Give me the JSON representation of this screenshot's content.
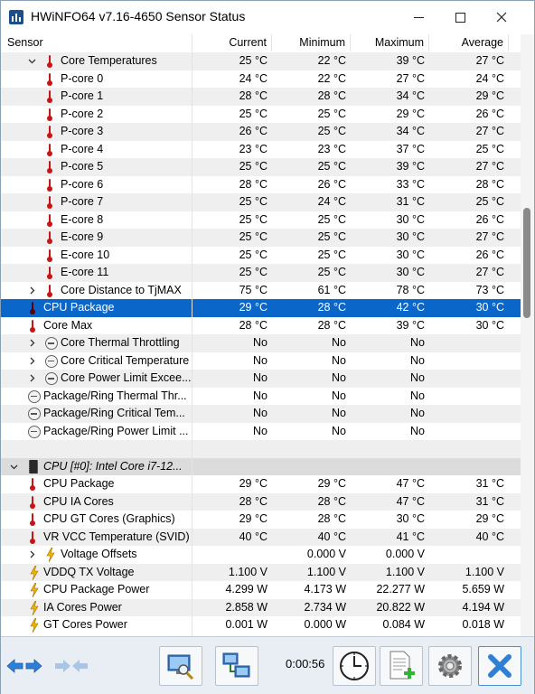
{
  "window": {
    "title": "HWiNFO64 v7.16-4650 Sensor Status"
  },
  "columns": {
    "sensor": "Sensor",
    "current": "Current",
    "minimum": "Minimum",
    "maximum": "Maximum",
    "average": "Average"
  },
  "rows": [
    {
      "label": "Core Temperatures",
      "cur": "25 °C",
      "min": "22 °C",
      "max": "39 °C",
      "avg": "27 °C"
    },
    {
      "label": "P-core 0",
      "cur": "24 °C",
      "min": "22 °C",
      "max": "27 °C",
      "avg": "24 °C"
    },
    {
      "label": "P-core 1",
      "cur": "28 °C",
      "min": "28 °C",
      "max": "34 °C",
      "avg": "29 °C"
    },
    {
      "label": "P-core 2",
      "cur": "25 °C",
      "min": "25 °C",
      "max": "29 °C",
      "avg": "26 °C"
    },
    {
      "label": "P-core 3",
      "cur": "26 °C",
      "min": "25 °C",
      "max": "34 °C",
      "avg": "27 °C"
    },
    {
      "label": "P-core 4",
      "cur": "23 °C",
      "min": "23 °C",
      "max": "37 °C",
      "avg": "25 °C"
    },
    {
      "label": "P-core 5",
      "cur": "25 °C",
      "min": "25 °C",
      "max": "39 °C",
      "avg": "27 °C"
    },
    {
      "label": "P-core 6",
      "cur": "28 °C",
      "min": "26 °C",
      "max": "33 °C",
      "avg": "28 °C"
    },
    {
      "label": "P-core 7",
      "cur": "25 °C",
      "min": "24 °C",
      "max": "31 °C",
      "avg": "25 °C"
    },
    {
      "label": "E-core 8",
      "cur": "25 °C",
      "min": "25 °C",
      "max": "30 °C",
      "avg": "26 °C"
    },
    {
      "label": "E-core 9",
      "cur": "25 °C",
      "min": "25 °C",
      "max": "30 °C",
      "avg": "27 °C"
    },
    {
      "label": "E-core 10",
      "cur": "25 °C",
      "min": "25 °C",
      "max": "30 °C",
      "avg": "26 °C"
    },
    {
      "label": "E-core 11",
      "cur": "25 °C",
      "min": "25 °C",
      "max": "30 °C",
      "avg": "27 °C"
    },
    {
      "label": "Core Distance to TjMAX",
      "cur": "75 °C",
      "min": "61 °C",
      "max": "78 °C",
      "avg": "73 °C"
    },
    {
      "label": "CPU Package",
      "cur": "29 °C",
      "min": "28 °C",
      "max": "42 °C",
      "avg": "30 °C"
    },
    {
      "label": "Core Max",
      "cur": "28 °C",
      "min": "28 °C",
      "max": "39 °C",
      "avg": "30 °C"
    },
    {
      "label": "Core Thermal Throttling",
      "cur": "No",
      "min": "No",
      "max": "No",
      "avg": ""
    },
    {
      "label": "Core Critical Temperature",
      "cur": "No",
      "min": "No",
      "max": "No",
      "avg": ""
    },
    {
      "label": "Core Power Limit Excee...",
      "cur": "No",
      "min": "No",
      "max": "No",
      "avg": ""
    },
    {
      "label": "Package/Ring Thermal Thr...",
      "cur": "No",
      "min": "No",
      "max": "No",
      "avg": ""
    },
    {
      "label": "Package/Ring Critical Tem...",
      "cur": "No",
      "min": "No",
      "max": "No",
      "avg": ""
    },
    {
      "label": "Package/Ring Power Limit ...",
      "cur": "No",
      "min": "No",
      "max": "No",
      "avg": ""
    },
    {
      "label": "",
      "cur": "",
      "min": "",
      "max": "",
      "avg": ""
    },
    {
      "label": "CPU [#0]: Intel Core i7-12...",
      "cur": "",
      "min": "",
      "max": "",
      "avg": ""
    },
    {
      "label": "CPU Package",
      "cur": "29 °C",
      "min": "29 °C",
      "max": "47 °C",
      "avg": "31 °C"
    },
    {
      "label": "CPU IA Cores",
      "cur": "28 °C",
      "min": "28 °C",
      "max": "47 °C",
      "avg": "31 °C"
    },
    {
      "label": "CPU GT Cores (Graphics)",
      "cur": "29 °C",
      "min": "28 °C",
      "max": "30 °C",
      "avg": "29 °C"
    },
    {
      "label": "VR VCC Temperature (SVID)",
      "cur": "40 °C",
      "min": "40 °C",
      "max": "41 °C",
      "avg": "40 °C"
    },
    {
      "label": "Voltage Offsets",
      "cur": "",
      "min": "0.000 V",
      "max": "0.000 V",
      "avg": ""
    },
    {
      "label": "VDDQ TX Voltage",
      "cur": "1.100 V",
      "min": "1.100 V",
      "max": "1.100 V",
      "avg": "1.100 V"
    },
    {
      "label": "CPU Package Power",
      "cur": "4.299 W",
      "min": "4.173 W",
      "max": "22.277 W",
      "avg": "5.659 W"
    },
    {
      "label": "IA Cores Power",
      "cur": "2.858 W",
      "min": "2.734 W",
      "max": "20.822 W",
      "avg": "4.194 W"
    },
    {
      "label": "GT Cores Power",
      "cur": "0.001 W",
      "min": "0.000 W",
      "max": "0.084 W",
      "avg": "0.018 W"
    }
  ],
  "toolbar": {
    "timer": "0:00:56"
  },
  "colors": {
    "selection": "#0a66c8",
    "thermometer": "#c81414",
    "bolt": "#f0b400"
  },
  "icons": [
    "thermometer-icon",
    "gauge-icon",
    "bolt-icon",
    "chip-icon",
    "chevron-icon",
    "nav-arrows-icon",
    "monitor-search-icon",
    "network-icon",
    "clock-icon",
    "report-add-icon",
    "gear-icon",
    "close-icon"
  ]
}
